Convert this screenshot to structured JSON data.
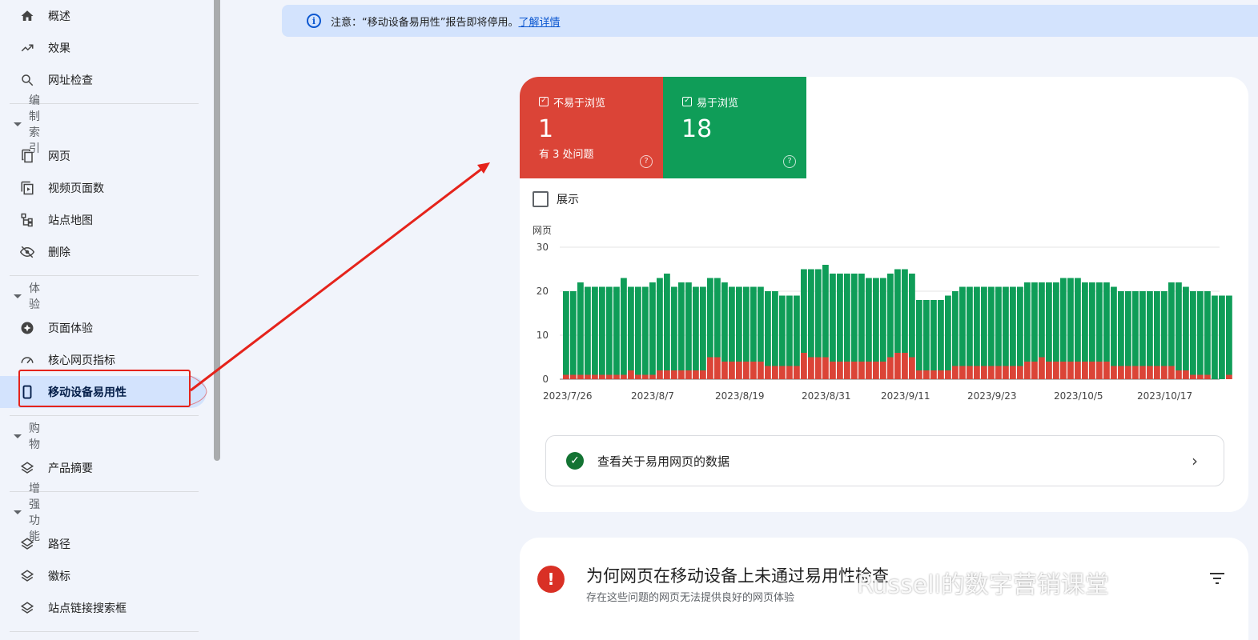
{
  "sidebar": {
    "top_items": [
      {
        "label": "概述",
        "icon": "home-icon"
      },
      {
        "label": "效果",
        "icon": "trending-up-icon"
      },
      {
        "label": "网址检查",
        "icon": "search-icon"
      }
    ],
    "sections": [
      {
        "label": "编制索引",
        "items": [
          {
            "label": "网页",
            "icon": "pages-icon"
          },
          {
            "label": "视频页面数",
            "icon": "video-pages-icon"
          },
          {
            "label": "站点地图",
            "icon": "sitemap-icon"
          },
          {
            "label": "删除",
            "icon": "eye-off-icon"
          }
        ]
      },
      {
        "label": "体验",
        "items": [
          {
            "label": "页面体验",
            "icon": "page-experience-icon"
          },
          {
            "label": "核心网页指标",
            "icon": "speedometer-icon"
          },
          {
            "label": "移动设备易用性",
            "icon": "smartphone-icon",
            "active": true
          }
        ]
      },
      {
        "label": "购物",
        "items": [
          {
            "label": "产品摘要",
            "icon": "layers-icon"
          }
        ]
      },
      {
        "label": "增强功能",
        "items": [
          {
            "label": "路径",
            "icon": "layers-icon"
          },
          {
            "label": "徽标",
            "icon": "layers-icon"
          },
          {
            "label": "站点链接搜索框",
            "icon": "layers-icon"
          }
        ]
      }
    ]
  },
  "banner": {
    "text": "注意：“移动设备易用性”报告即将停用。",
    "link": "了解详情"
  },
  "summary": {
    "not_usable": {
      "label": "不易于浏览",
      "count": "1",
      "issues": "有 3 处问题",
      "color": "#db4437"
    },
    "usable": {
      "label": "易于浏览",
      "count": "18",
      "color": "#0f9d58"
    }
  },
  "show_label": "展示",
  "data_link_label": "查看关于易用网页的数据",
  "issues_card": {
    "title": "为何网页在移动设备上未通过易用性检查",
    "subtitle": "存在这些问题的网页无法提供良好的网页体验"
  },
  "watermark": "Russell的数字营销课堂",
  "chart_data": {
    "type": "bar",
    "stacked": true,
    "ylabel": "网页",
    "ylim": [
      0,
      30
    ],
    "yticks": [
      0,
      10,
      20,
      30
    ],
    "xticks": [
      "2023/7/26",
      "2023/8/7",
      "2023/8/19",
      "2023/8/31",
      "2023/9/11",
      "2023/9/23",
      "2023/10/5",
      "2023/10/17"
    ],
    "series": [
      {
        "name": "不易于浏览",
        "color": "#db4437",
        "values": [
          1,
          1,
          1,
          1,
          1,
          1,
          1,
          1,
          1,
          2,
          1,
          1,
          1,
          2,
          2,
          2,
          2,
          2,
          2,
          2,
          5,
          5,
          4,
          4,
          4,
          4,
          4,
          4,
          3,
          3,
          3,
          3,
          3,
          6,
          5,
          5,
          5,
          4,
          4,
          4,
          4,
          4,
          4,
          4,
          4,
          5,
          6,
          6,
          5,
          2,
          2,
          2,
          2,
          2,
          3,
          3,
          3,
          3,
          3,
          3,
          3,
          3,
          3,
          3,
          4,
          4,
          5,
          4,
          4,
          4,
          4,
          4,
          4,
          4,
          4,
          4,
          3,
          3,
          3,
          3,
          3,
          3,
          3,
          3,
          3,
          2,
          2,
          1,
          1,
          1,
          0,
          0,
          1
        ]
      },
      {
        "name": "易于浏览",
        "color": "#0f9d58",
        "values": [
          19,
          19,
          21,
          20,
          20,
          20,
          20,
          20,
          22,
          19,
          20,
          20,
          21,
          21,
          22,
          19,
          20,
          20,
          19,
          19,
          18,
          18,
          18,
          17,
          17,
          17,
          17,
          17,
          17,
          17,
          16,
          16,
          16,
          19,
          20,
          20,
          21,
          20,
          20,
          20,
          20,
          20,
          19,
          19,
          19,
          19,
          19,
          19,
          19,
          16,
          16,
          16,
          16,
          17,
          17,
          18,
          18,
          18,
          18,
          18,
          18,
          18,
          18,
          18,
          18,
          18,
          17,
          18,
          18,
          19,
          19,
          19,
          18,
          18,
          18,
          18,
          18,
          17,
          17,
          17,
          17,
          17,
          17,
          17,
          19,
          20,
          19,
          19,
          19,
          19,
          19,
          19,
          18
        ]
      }
    ]
  }
}
